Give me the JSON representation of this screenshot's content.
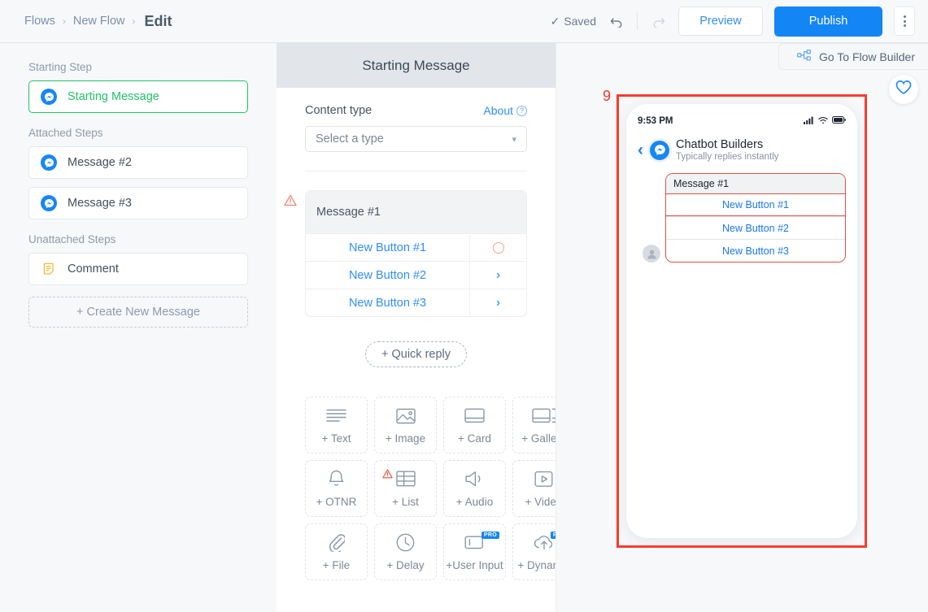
{
  "topbar": {
    "breadcrumb": [
      "Flows",
      "New Flow"
    ],
    "breadcrumb_sep": "›",
    "current": "Edit",
    "saved_label": "Saved",
    "saved_check": "✓",
    "preview_label": "Preview",
    "publish_label": "Publish",
    "undo_icon": "undo-arrow-icon",
    "redo_icon": "redo-arrow-icon",
    "kebab_icon": "more-vertical-icon",
    "accent_blue": "#1485f5",
    "link_blue": "#2f8ef7"
  },
  "flow_builder_pill": {
    "label": "Go To Flow Builder",
    "icon": "flow-builder-nodes-icon"
  },
  "favorite": {
    "icon": "heart-icon",
    "color": "#1485f5"
  },
  "sidebar": {
    "sections": [
      {
        "label": "Starting Step",
        "items": [
          {
            "label": "Starting Message",
            "icon": "messenger-icon",
            "active": true
          }
        ]
      },
      {
        "label": "Attached Steps",
        "items": [
          {
            "label": "Message #2",
            "icon": "messenger-icon",
            "active": false
          },
          {
            "label": "Message #3",
            "icon": "messenger-icon",
            "active": false
          }
        ]
      },
      {
        "label": "Unattached Steps",
        "items": [
          {
            "label": "Comment",
            "icon": "comment-note-icon",
            "active": false
          }
        ]
      }
    ],
    "create_new_label": "+ Create New Message",
    "active_color": "#23c268"
  },
  "center": {
    "title": "Starting Message",
    "content_type_label": "Content type",
    "about_label": "About",
    "about_icon": "question-circle-icon",
    "select_placeholder": "Select a type",
    "select_caret_icon": "chevron-down-icon",
    "warning_icon": "warning-triangle-icon",
    "message_card": {
      "title": "Message #1",
      "buttons": [
        {
          "label": "New Button #1",
          "action_icon": "circle-unlinked-icon"
        },
        {
          "label": "New Button #2",
          "action_icon": "chevron-right-icon"
        },
        {
          "label": "New Button #3",
          "action_icon": "chevron-right-icon"
        }
      ]
    },
    "quick_reply_label": "+ Quick reply",
    "add_blocks": [
      {
        "label": "+ Text",
        "icon": "text-lines-icon",
        "pro": false,
        "warn": false
      },
      {
        "label": "+ Image",
        "icon": "image-icon",
        "pro": false,
        "warn": false
      },
      {
        "label": "+ Card",
        "icon": "card-icon",
        "pro": false,
        "warn": false
      },
      {
        "label": "+ Gallery",
        "icon": "gallery-icon",
        "pro": false,
        "warn": false
      },
      {
        "label": "+ OTNR",
        "icon": "bell-icon",
        "pro": false,
        "warn": false
      },
      {
        "label": "+ List",
        "icon": "list-table-icon",
        "pro": false,
        "warn": true
      },
      {
        "label": "+ Audio",
        "icon": "speaker-icon",
        "pro": false,
        "warn": false
      },
      {
        "label": "+ Video",
        "icon": "video-play-icon",
        "pro": false,
        "warn": false
      },
      {
        "label": "+ File",
        "icon": "paperclip-icon",
        "pro": false,
        "warn": false
      },
      {
        "label": "+ Delay",
        "icon": "clock-icon",
        "pro": false,
        "warn": false
      },
      {
        "label": "+User Input",
        "icon": "user-input-icon",
        "pro": true,
        "warn": false
      },
      {
        "label": "+ Dynamic",
        "icon": "cloud-upload-icon",
        "pro": true,
        "warn": false
      }
    ],
    "pro_badge_label": "PRO"
  },
  "preview": {
    "annotation_number": "9",
    "annotation_color": "#fa3c2d",
    "status_time": "9:53 PM",
    "status_icons": [
      "signal-bars-icon",
      "wifi-icon",
      "battery-icon"
    ],
    "back_icon": "chevron-left-icon",
    "page_name": "Chatbot Builders",
    "page_status": "Typically replies instantly",
    "avatar_icon": "messenger-icon",
    "recipient_avatar_icon": "user-avatar-icon",
    "bubble": {
      "title": "Message #1",
      "buttons": [
        {
          "label": "New Button #1",
          "highlighted": true
        },
        {
          "label": "New Button #2",
          "highlighted": false
        },
        {
          "label": "New Button #3",
          "highlighted": false
        }
      ]
    }
  }
}
